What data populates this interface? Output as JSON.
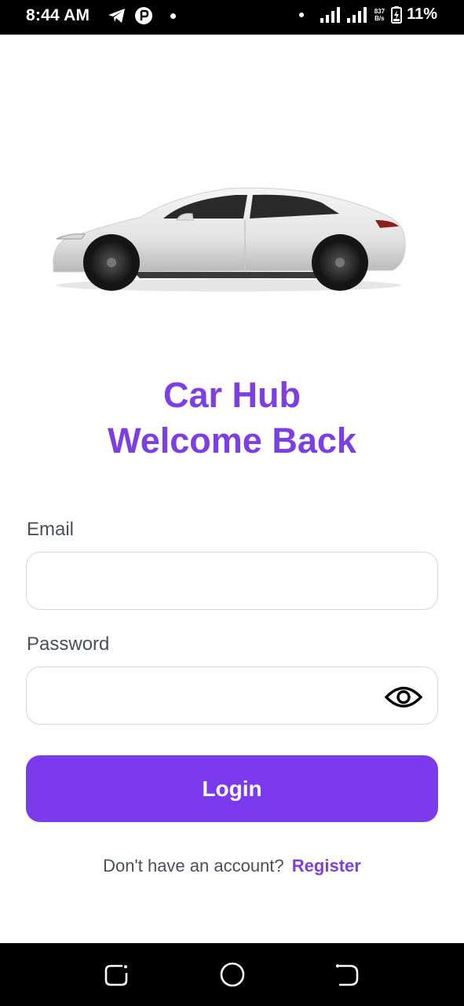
{
  "status_bar": {
    "time": "8:44 AM",
    "net_speed_value": "837",
    "net_speed_unit": "B/s",
    "battery": "11%",
    "icons": [
      "telegram-icon",
      "app-notification-icon",
      "dot-icon",
      "signal-icon",
      "signal-icon",
      "battery-icon"
    ]
  },
  "hero": {
    "image": "white-sedan-car"
  },
  "title": {
    "line1": "Car Hub",
    "line2": "Welcome Back"
  },
  "form": {
    "email_label": "Email",
    "email_value": "",
    "password_label": "Password",
    "password_value": "",
    "login_label": "Login"
  },
  "register": {
    "prompt": "Don't have an account?",
    "link": "Register"
  },
  "nav_bar": {
    "icons": [
      "recent-apps-icon",
      "home-icon",
      "back-icon"
    ]
  },
  "colors": {
    "accent": "#7c3aed",
    "title": "#7b3fe4",
    "text_muted": "#4a4f5c",
    "border": "#d6d6dd"
  }
}
